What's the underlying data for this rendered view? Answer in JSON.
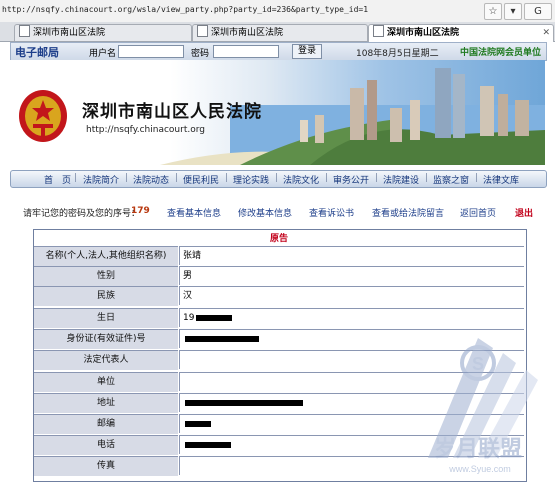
{
  "browser": {
    "url": "http://nsqfy.chinacourt.org/wsla/view_party.php?party_id=236&party_type_id=1",
    "tabs": [
      {
        "label": "深圳市南山区法院",
        "active": false
      },
      {
        "label": "深圳市南山区法院",
        "active": false
      },
      {
        "label": "深圳市南山区法院",
        "active": true
      }
    ]
  },
  "header": {
    "mailbox_label": "电子邮局",
    "username_label": "用户名",
    "password_label": "密码",
    "login_button": "登录",
    "date_text": "108年8月5日星期二",
    "member_text": "中国法院网会员单位",
    "court_name": "深圳市南山区人民法院",
    "court_url": "http://nsqfy.chinacourt.org"
  },
  "nav": {
    "items": [
      "首　页",
      "法院简介",
      "法院动态",
      "便民利民",
      "理论实践",
      "法院文化",
      "审务公开",
      "法院建设",
      "监察之窗",
      "法律文库"
    ]
  },
  "actions": {
    "serial_label": "请牢记您的密码及您的序号：",
    "serial_number": "179",
    "links": [
      "查看基本信息",
      "修改基本信息",
      "查看诉讼书",
      "查看或给法院留言",
      "返回首页"
    ],
    "exit": "退出"
  },
  "form": {
    "title": "原告",
    "rows": [
      {
        "label": "名称(个人,法人,其他组织名称)",
        "value": "张靖"
      },
      {
        "label": "性别",
        "value": "男"
      },
      {
        "label": "民族",
        "value": "汉"
      },
      {
        "label": "生日",
        "value": "19"
      },
      {
        "label": "身份证(有效证件)号",
        "value": ""
      },
      {
        "label": "法定代表人",
        "value": ""
      },
      {
        "label": "单位",
        "value": ""
      },
      {
        "label": "地址",
        "value": ""
      },
      {
        "label": "邮编",
        "value": ""
      },
      {
        "label": "电话",
        "value": ""
      },
      {
        "label": "传真",
        "value": ""
      }
    ]
  },
  "watermark": {
    "text": "岁月联盟",
    "url": "www.Syue.com"
  }
}
